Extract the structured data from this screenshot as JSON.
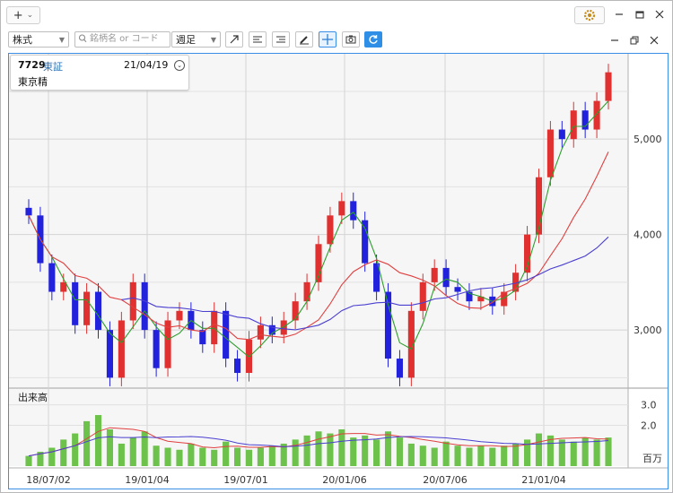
{
  "titlebar": {
    "add_label": "+",
    "chevron": "⌄"
  },
  "toolbar": {
    "type_select": "株式",
    "search_placeholder": "銘柄名 or コード",
    "period_select": "週足"
  },
  "symbol": {
    "code": "7729",
    "market": "東証",
    "date": "21/04/19",
    "name": "東京精"
  },
  "colors": {
    "up": "#e03030",
    "down": "#2222dd",
    "ma_short": "#2e9e2e",
    "ma_mid": "#e04040",
    "ma_long": "#4a3fd0",
    "volume": "#6cc24a",
    "accent": "#3b8ee6"
  },
  "chart_data": [
    {
      "type": "candlestick",
      "title": "",
      "x": [
        "18/07/02",
        "19/01/04",
        "19/07/01",
        "20/01/06",
        "20/07/06",
        "21/01/04"
      ],
      "y_ticks": [
        "5,000",
        "4,000",
        "3,000"
      ],
      "ylim": [
        2400,
        5800
      ],
      "grid": true,
      "series": [
        {
          "name": "price",
          "values": [
            4200,
            3700,
            3400,
            3500,
            3050,
            3400,
            3000,
            2500,
            3100,
            3500,
            3000,
            2600,
            3100,
            3200,
            3000,
            2850,
            3200,
            2700,
            2550,
            2900,
            3050,
            2950,
            3100,
            3300,
            3500,
            3900,
            4200,
            4350,
            4150,
            3700,
            3400,
            2700,
            2500,
            3200,
            3500,
            3650,
            3450,
            3400,
            3300,
            3350,
            3250,
            3400,
            3600,
            4000,
            4600,
            5100,
            5000,
            5300,
            5100,
            5400,
            5700
          ]
        }
      ]
    },
    {
      "type": "bar",
      "title": "出来高",
      "y_ticks": [
        "3.0",
        "2.0"
      ],
      "unit": "百万",
      "series": [
        {
          "name": "volume",
          "values": [
            0.5,
            0.7,
            0.9,
            1.3,
            1.6,
            2.2,
            2.5,
            1.8,
            1.1,
            1.4,
            1.7,
            1.0,
            0.9,
            0.8,
            1.1,
            0.9,
            0.8,
            1.2,
            0.9,
            0.8,
            0.9,
            1.0,
            1.1,
            1.3,
            1.5,
            1.7,
            1.6,
            1.8,
            1.4,
            1.5,
            1.3,
            1.7,
            1.4,
            1.1,
            1.0,
            0.9,
            1.2,
            1.0,
            0.9,
            1.0,
            0.9,
            1.0,
            1.1,
            1.3,
            1.6,
            1.5,
            1.3,
            1.2,
            1.4,
            1.3,
            1.4
          ]
        }
      ]
    }
  ]
}
